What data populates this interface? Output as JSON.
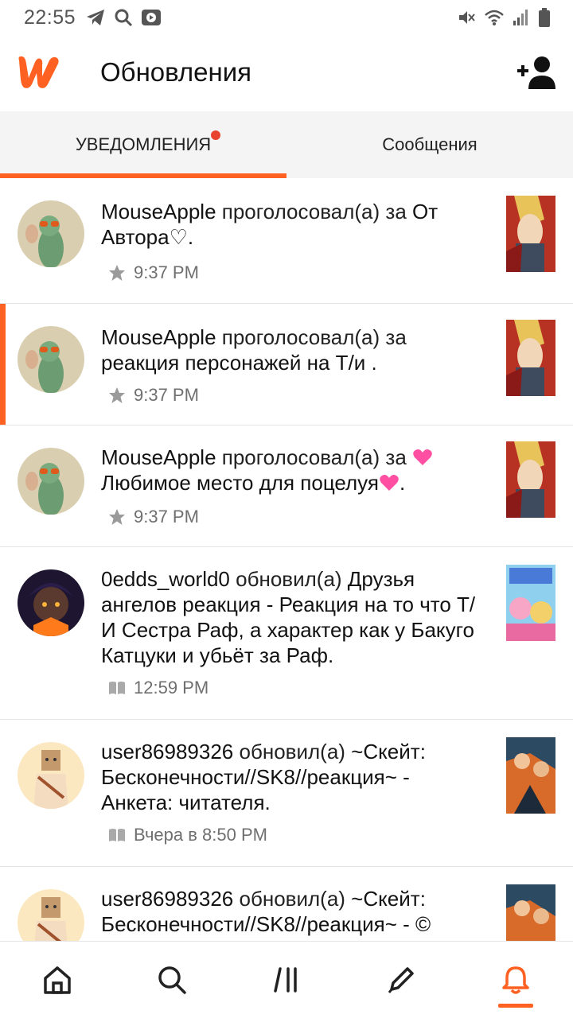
{
  "status": {
    "time": "22:55"
  },
  "header": {
    "title": "Обновления"
  },
  "tabs": [
    {
      "label": "УВЕДОМЛЕНИЯ",
      "active": true,
      "has_dot": true
    },
    {
      "label": "Сообщения",
      "active": false
    }
  ],
  "notifications": [
    {
      "user": "MouseApple",
      "action": " проголосовал(а) за ",
      "story": "От Автора♡",
      "tail": ".",
      "time": "9:37 PM",
      "meta_icon": "star-icon",
      "highlighted": false
    },
    {
      "user": "MouseApple",
      "action": " проголосовал(а) за ",
      "story": "реакция персонажей на Т/и",
      "tail": " .",
      "time": "9:37 PM",
      "meta_icon": "star-icon",
      "highlighted": true
    },
    {
      "user": "MouseApple",
      "action": " проголосовал(а) за ",
      "story": "Любимое место для поцелуя",
      "tail": ".",
      "time": "9:37 PM",
      "meta_icon": "star-icon",
      "highlighted": false
    },
    {
      "user": "0edds_world0",
      "action": " обновил(а) ",
      "story": "Друзья ангелов реакция - Реакция на то что Т/И Сестра Раф, а характер как у Бакуго Катцуки и убьёт за Раф",
      "tail": ".",
      "time": "12:59 PM",
      "meta_icon": "book-icon",
      "highlighted": false
    },
    {
      "user": "user86989326",
      "action": " обновил(а) ",
      "story": "~Скейт: Бесконечности//SK8//реакция~ - Анкета: читателя",
      "tail": ".",
      "time": "Вчера в 8:50 PM",
      "meta_icon": "book-icon",
      "highlighted": false
    },
    {
      "user": "user86989326",
      "action": " обновил(а) ",
      "story": "~Скейт: Бесконечности//SK8//реакция~ - ©",
      "tail": "",
      "time": "",
      "meta_icon": "book-icon",
      "highlighted": false
    }
  ],
  "bottom_nav": [
    {
      "name": "home-icon",
      "active": false
    },
    {
      "name": "search-icon",
      "active": false
    },
    {
      "name": "library-icon",
      "active": false
    },
    {
      "name": "write-icon",
      "active": false
    },
    {
      "name": "bell-icon",
      "active": true
    }
  ],
  "colors": {
    "accent": "#ff6122",
    "dot": "#e8432e"
  }
}
